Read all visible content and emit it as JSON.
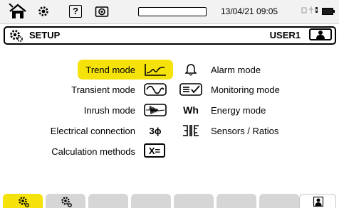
{
  "status_bar": {
    "datetime": "13/04/21 09:05",
    "help_glyph": "?",
    "progress_fraction": 0.0
  },
  "header": {
    "title": "SETUP",
    "user": "USER1"
  },
  "menu": {
    "left": [
      {
        "label": "Trend mode",
        "icon": "trend-icon",
        "selected": true
      },
      {
        "label": "Transient mode",
        "icon": "transient-icon"
      },
      {
        "label": "Inrush mode",
        "icon": "inrush-icon"
      },
      {
        "label": "Electrical connection",
        "icon_text": "3ϕ"
      },
      {
        "label": "Calculation methods",
        "icon_text": "X="
      }
    ],
    "right": [
      {
        "label": "Alarm mode",
        "icon": "bell-icon"
      },
      {
        "label": "Monitoring mode",
        "icon": "monitoring-icon"
      },
      {
        "label": "Energy mode",
        "icon_text": "Wh"
      },
      {
        "label": "Sensors / Ratios",
        "icon": "sensors-icon"
      }
    ]
  },
  "colors": {
    "accent": "#f5e20a",
    "tab_inactive": "#d6d6d6"
  }
}
